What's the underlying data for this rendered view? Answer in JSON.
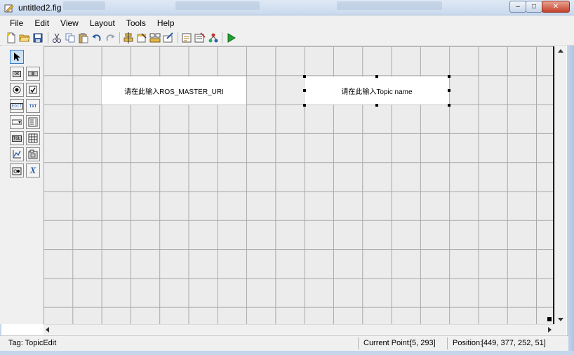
{
  "window": {
    "title": "untitled2.fig",
    "controls": {
      "minimize": "–",
      "maximize": "□",
      "close": "✕"
    }
  },
  "menubar": {
    "items": [
      "File",
      "Edit",
      "View",
      "Layout",
      "Tools",
      "Help"
    ]
  },
  "toolbar": {
    "icons": [
      "new-file-icon",
      "open-folder-icon",
      "save-icon",
      "cut-icon",
      "copy-icon",
      "paste-icon",
      "undo-icon",
      "redo-icon",
      "align-objects-icon",
      "menu-editor-icon",
      "tab-order-icon",
      "toolbar-editor-icon",
      "m-file-editor-icon",
      "property-inspector-icon",
      "object-browser-icon",
      "run-figure-icon"
    ]
  },
  "palette": {
    "tools": [
      {
        "name": "select-tool",
        "label": "",
        "selected": true
      },
      {
        "name": "push-button-tool",
        "label": "OK"
      },
      {
        "name": "slider-tool",
        "label": ""
      },
      {
        "name": "radio-button-tool",
        "label": ""
      },
      {
        "name": "check-box-tool",
        "label": ""
      },
      {
        "name": "edit-text-tool",
        "label": "EDIT"
      },
      {
        "name": "static-text-tool",
        "label": "TXT"
      },
      {
        "name": "popup-menu-tool",
        "label": ""
      },
      {
        "name": "listbox-tool",
        "label": ""
      },
      {
        "name": "toggle-button-tool",
        "label": "TGL"
      },
      {
        "name": "table-tool",
        "label": ""
      },
      {
        "name": "axes-tool",
        "label": ""
      },
      {
        "name": "panel-tool",
        "label": ""
      },
      {
        "name": "button-group-tool",
        "label": ""
      },
      {
        "name": "activex-tool",
        "label": "X"
      }
    ]
  },
  "canvas": {
    "controls": [
      {
        "name": "ros-master-uri-edit",
        "text": "请在此输入ROS_MASTER_URI",
        "selected": false
      },
      {
        "name": "topic-edit",
        "text": "请在此输入Topic name",
        "selected": true
      }
    ]
  },
  "statusbar": {
    "tag": "Tag: TopicEdit",
    "current_point_label": "Current Point:",
    "current_point_value": "[5, 293]",
    "position_label": "Position:",
    "position_value": "[449, 377, 252, 51]"
  }
}
